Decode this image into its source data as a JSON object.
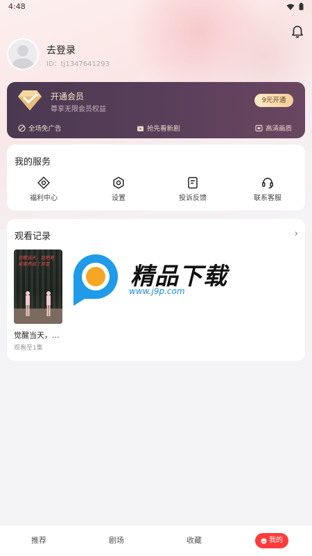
{
  "status_bar": {
    "time": "4:48"
  },
  "profile": {
    "login_label": "去登录",
    "user_id": "ID：tj1347641293"
  },
  "vip": {
    "title": "开通会员",
    "subtitle": "尊享无限会员权益",
    "button_label": "9元开通",
    "perks": [
      {
        "label": "全场免广告",
        "icon": "no-ads-icon"
      },
      {
        "label": "抢先看新剧",
        "icon": "tv-icon"
      },
      {
        "label": "高清画质",
        "icon": "hd-icon"
      }
    ]
  },
  "services": {
    "title": "我的服务",
    "items": [
      {
        "label": "福利中心",
        "icon": "gift-icon"
      },
      {
        "label": "设置",
        "icon": "settings-icon"
      },
      {
        "label": "投诉反馈",
        "icon": "feedback-icon"
      },
      {
        "label": "联系客服",
        "icon": "headset-icon"
      }
    ]
  },
  "history": {
    "title": "观看记录",
    "items": [
      {
        "title": "觉醒当天，...",
        "progress": "观看至1集",
        "poster_text": "觉醒当天，我把男闺蜜养成了首富"
      }
    ]
  },
  "watermark": {
    "text": "精品下载",
    "url": "www.j9p.com"
  },
  "tabs": [
    {
      "label": "推荐",
      "active": false
    },
    {
      "label": "剧场",
      "active": false
    },
    {
      "label": "收藏",
      "active": false
    },
    {
      "label": "我的",
      "active": true
    }
  ],
  "colors": {
    "accent": "#ff3b3b",
    "vip_bg": "#4a3851",
    "vip_gold": "#f4cf98"
  }
}
